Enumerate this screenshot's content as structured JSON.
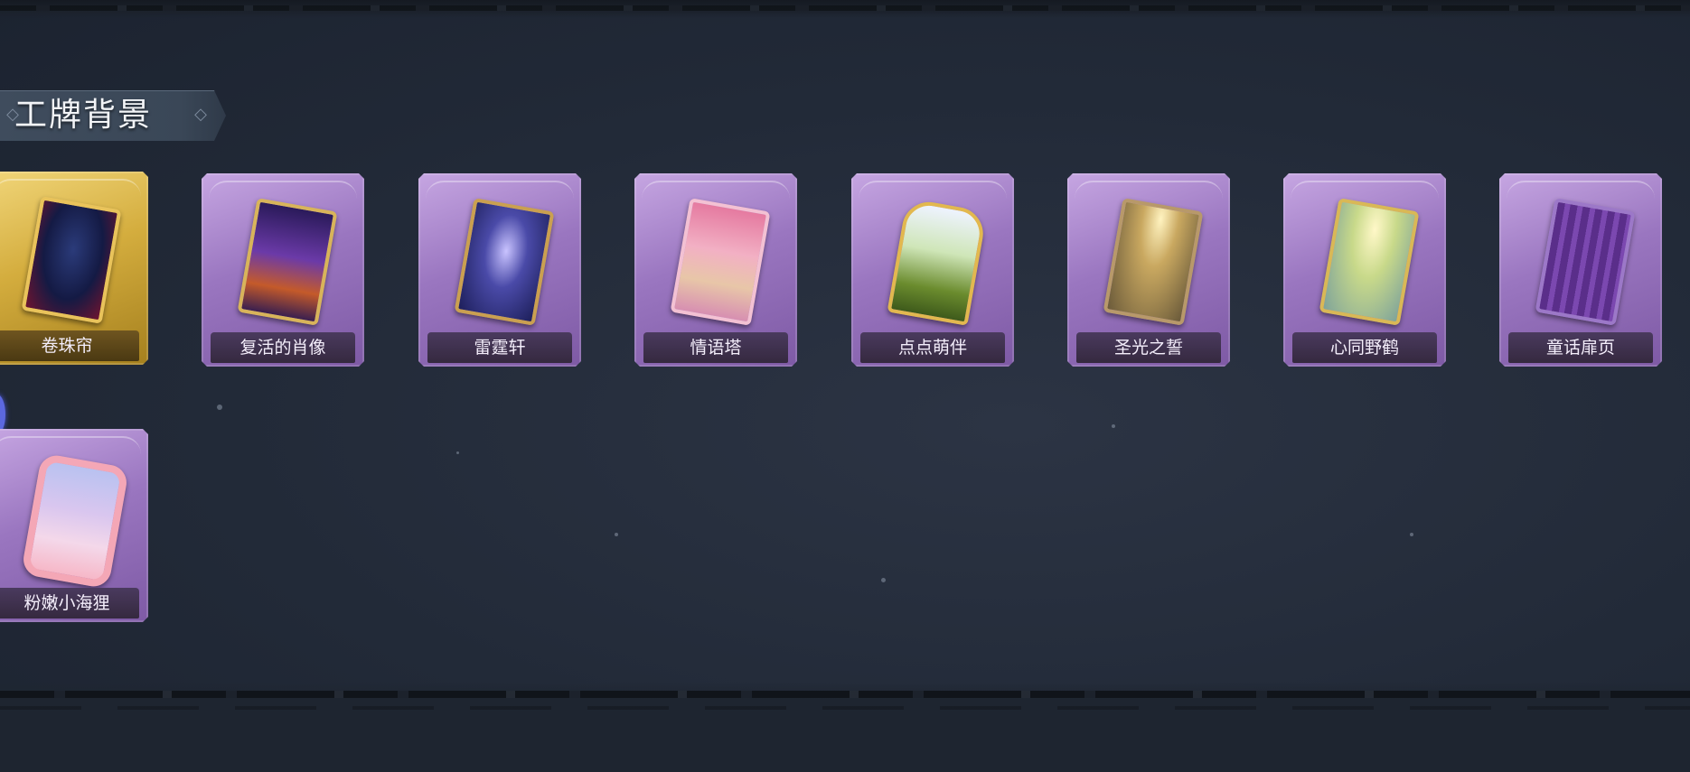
{
  "section": {
    "title": "工牌背景"
  },
  "cards": [
    {
      "label": "卷珠帘",
      "selected": true
    },
    {
      "label": "复活的肖像",
      "selected": false
    },
    {
      "label": "雷霆轩",
      "selected": false
    },
    {
      "label": "情语塔",
      "selected": false
    },
    {
      "label": "点点萌伴",
      "selected": false
    },
    {
      "label": "圣光之誓",
      "selected": false
    },
    {
      "label": "心同野鹤",
      "selected": false
    },
    {
      "label": "童话扉页",
      "selected": false
    },
    {
      "label": "粉嫩小海狸",
      "selected": false
    }
  ],
  "colors": {
    "background": "#232b39",
    "card_purple": "#9a76c0",
    "card_selected_gold": "#d4ad3e",
    "title_text": "#f2f4f7"
  }
}
